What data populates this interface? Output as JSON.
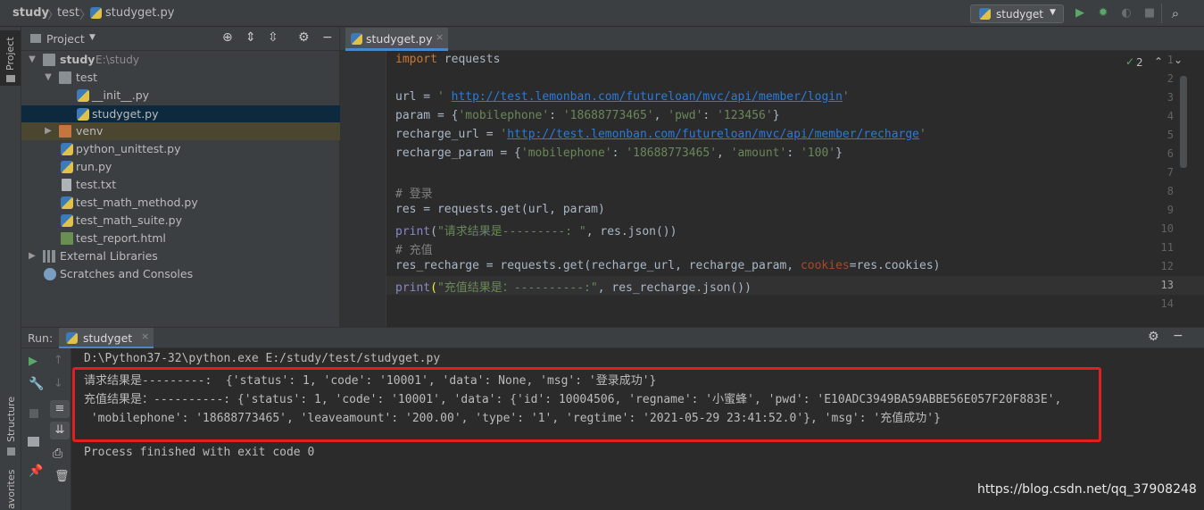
{
  "breadcrumb": {
    "root": "study",
    "folder": "test",
    "file": "studyget.py"
  },
  "toolbar": {
    "run_config": "studyget"
  },
  "left_strip": {
    "project_label": "Project",
    "structure_label": "Structure",
    "favorites_label": "avorites"
  },
  "project_panel": {
    "title": "Project",
    "tree": [
      {
        "label": "study",
        "path": "E:\\study",
        "type": "folder"
      },
      {
        "label": "test",
        "type": "folder"
      },
      {
        "label": "__init__.py",
        "type": "py"
      },
      {
        "label": "studyget.py",
        "type": "py",
        "selected": true
      },
      {
        "label": "venv",
        "type": "folder-excluded"
      },
      {
        "label": "python_unittest.py",
        "type": "py"
      },
      {
        "label": "run.py",
        "type": "py"
      },
      {
        "label": "test.txt",
        "type": "txt"
      },
      {
        "label": "test_math_method.py",
        "type": "py"
      },
      {
        "label": "test_math_suite.py",
        "type": "py"
      },
      {
        "label": "test_report.html",
        "type": "html"
      },
      {
        "label": "External Libraries",
        "type": "lib"
      },
      {
        "label": "Scratches and Consoles",
        "type": "scratch"
      }
    ]
  },
  "editor": {
    "tab_label": "studyget.py",
    "inspection_count": "2",
    "line_numbers": [
      "1",
      "2",
      "3",
      "4",
      "5",
      "6",
      "7",
      "8",
      "9",
      "10",
      "11",
      "12",
      "13",
      "14"
    ],
    "code": {
      "l1_kw": "import",
      "l1_rest": " requests",
      "l3_a": "url = ",
      "l3_q1": "' ",
      "l3_url": "http://test.lemonban.com/futureloan/mvc/api/member/login",
      "l3_q2": "'",
      "l4_a": "param = {",
      "l4_k1": "'mobilephone'",
      "l4_b": ": ",
      "l4_v1": "'18688773465'",
      "l4_c": ", ",
      "l4_k2": "'pwd'",
      "l4_d": ": ",
      "l4_v2": "'123456'",
      "l4_e": "}",
      "l5_a": "recharge_url = ",
      "l5_q1": "'",
      "l5_url": "http://test.lemonban.com/futureloan/mvc/api/member/recharge",
      "l5_q2": "'",
      "l6_a": "recharge_param = {",
      "l6_k1": "'mobilephone'",
      "l6_b": ": ",
      "l6_v1": "'18688773465'",
      "l6_c": ", ",
      "l6_k2": "'amount'",
      "l6_d": ": ",
      "l6_v2": "'100'",
      "l6_e": "}",
      "l8": "# 登录",
      "l9": "res = requests.get(url, param)",
      "l10_fn": "print",
      "l10_a": "(",
      "l10_s": "\"请求结果是---------: \"",
      "l10_b": ", res.json())",
      "l11": "# 充值",
      "l12_a": "res_recharge = requests.get(recharge_url, recharge_param, ",
      "l12_p": "cookies",
      "l12_b": "=res.cookies)",
      "l13_fn": "print",
      "l13_a": "(",
      "l13_s": "\"充值结果是：----------:\"",
      "l13_b": ", res_recharge.json())"
    }
  },
  "run_panel": {
    "label": "Run:",
    "tab": "studyget",
    "console": [
      "D:\\Python37-32\\python.exe E:/study/test/studyget.py",
      "请求结果是---------:  {'status': 1, 'code': '10001', 'data': None, 'msg': '登录成功'}",
      "充值结果是：----------: {'status': 1, 'code': '10001', 'data': {'id': 10004506, 'regname': '小蜜蜂', 'pwd': 'E10ADC3949BA59ABBE56E057F20F883E',",
      " 'mobilephone': '18688773465', 'leaveamount': '200.00', 'type': '1', 'regtime': '2021-05-29 23:41:52.0'}, 'msg': '充值成功'}",
      "",
      "Process finished with exit code 0"
    ]
  },
  "watermark": "https://blog.csdn.net/qq_37908248",
  "colors": {
    "highlight_border": "#e0201f",
    "selection": "#0d293e",
    "tab_underline": "#4a88c7"
  }
}
